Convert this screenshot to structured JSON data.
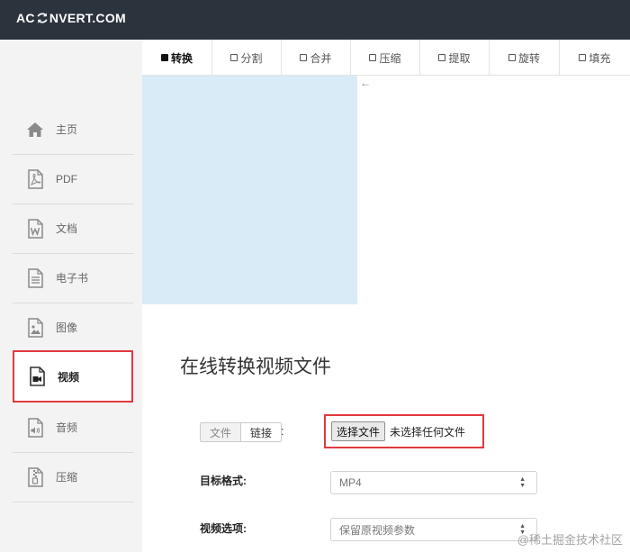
{
  "header": {
    "logo_left": "AC",
    "logo_right": "NVERT.COM"
  },
  "sidebar": {
    "items": [
      {
        "label": "主页",
        "icon": "home-icon"
      },
      {
        "label": "PDF",
        "icon": "pdf-file-icon"
      },
      {
        "label": "文档",
        "icon": "word-document-icon"
      },
      {
        "label": "电子书",
        "icon": "ebook-icon"
      },
      {
        "label": "图像",
        "icon": "image-file-icon"
      },
      {
        "label": "视频",
        "icon": "video-file-icon",
        "active": true
      },
      {
        "label": "音频",
        "icon": "audio-file-icon"
      },
      {
        "label": "压缩",
        "icon": "archive-file-icon"
      }
    ]
  },
  "tabs": [
    {
      "label": "转换",
      "active": true
    },
    {
      "label": "分割"
    },
    {
      "label": "合并"
    },
    {
      "label": "压缩"
    },
    {
      "label": "提取"
    },
    {
      "label": "旋转"
    },
    {
      "label": "填充"
    }
  ],
  "ad": {
    "arrow": "←"
  },
  "main": {
    "title": "在线转换视频文件",
    "source_toggle": {
      "file": "文件",
      "link": "链接",
      "colon": ":"
    },
    "file_input": {
      "button": "选择文件",
      "status": "未选择任何文件"
    },
    "target_format": {
      "label": "目标格式:",
      "value": "MP4"
    },
    "video_options": {
      "label": "视频选项:",
      "value": "保留原视频参数"
    }
  },
  "watermark": "@稀土掘金技术社区",
  "colors": {
    "topbar": "#2b333d",
    "sidebar_bg": "#f3f3f3",
    "highlight": "#e0393e",
    "ad_bg": "#d9ebf7"
  }
}
